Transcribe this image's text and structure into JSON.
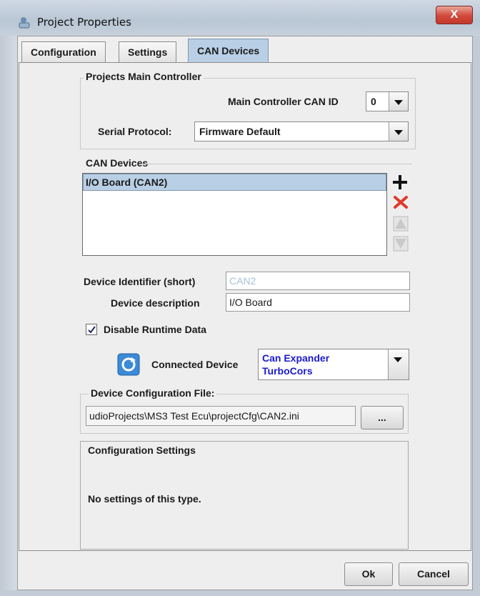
{
  "window": {
    "title": "Project Properties",
    "close_label": "X"
  },
  "tabs": [
    {
      "label": "Configuration"
    },
    {
      "label": "Settings"
    },
    {
      "label": "CAN Devices"
    }
  ],
  "main_controller": {
    "group_title": "Projects Main Controller",
    "can_id_label": "Main Controller CAN ID",
    "can_id_value": "0",
    "serial_protocol_label": "Serial Protocol:",
    "serial_protocol_value": "Firmware Default"
  },
  "can_devices": {
    "group_title": "CAN Devices",
    "items": [
      "I/O Board (CAN2)"
    ],
    "selected_index": 0,
    "icons": [
      "add-icon",
      "remove-icon",
      "move-up-icon",
      "move-down-icon"
    ],
    "identifier_label": "Device Identifier (short)",
    "identifier_value": "CAN2",
    "description_label": "Device description",
    "description_value": "I/O Board",
    "disable_runtime_label": "Disable Runtime Data",
    "disable_runtime_checked": true,
    "connected_device_label": "Connected Device",
    "connected_device_line1": "Can Expander",
    "connected_device_line2": "TurboCors",
    "config_file_group_title": "Device Configuration File:",
    "config_file_value": "udioProjects\\MS3 Test Ecu\\projectCfg\\CAN2.ini",
    "browse_label": "..."
  },
  "configuration_settings": {
    "group_title": "Configuration Settings",
    "message": "No settings of this type."
  },
  "footer": {
    "ok_label": "Ok",
    "cancel_label": "Cancel"
  },
  "colors": {
    "selection": "#b8cfe5",
    "connected_device_text": "#1a1ad0",
    "remove_icon": "#e03a2a"
  }
}
